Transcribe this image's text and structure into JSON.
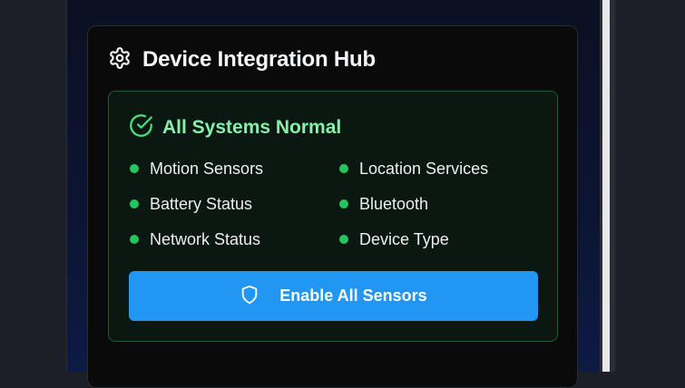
{
  "hub": {
    "title": "Device Integration Hub",
    "title_icon": "gear-icon"
  },
  "status": {
    "text": "All Systems Normal",
    "icon": "check-circle-icon",
    "color": "#86efac"
  },
  "sensors": [
    {
      "label": "Motion Sensors",
      "status_color": "#22c55e"
    },
    {
      "label": "Location Services",
      "status_color": "#22c55e"
    },
    {
      "label": "Battery Status",
      "status_color": "#22c55e"
    },
    {
      "label": "Bluetooth",
      "status_color": "#22c55e"
    },
    {
      "label": "Network Status",
      "status_color": "#22c55e"
    },
    {
      "label": "Device Type",
      "status_color": "#22c55e"
    }
  ],
  "enable_button": {
    "label": "Enable All Sensors",
    "icon": "shield-icon",
    "color": "#2196f3"
  }
}
